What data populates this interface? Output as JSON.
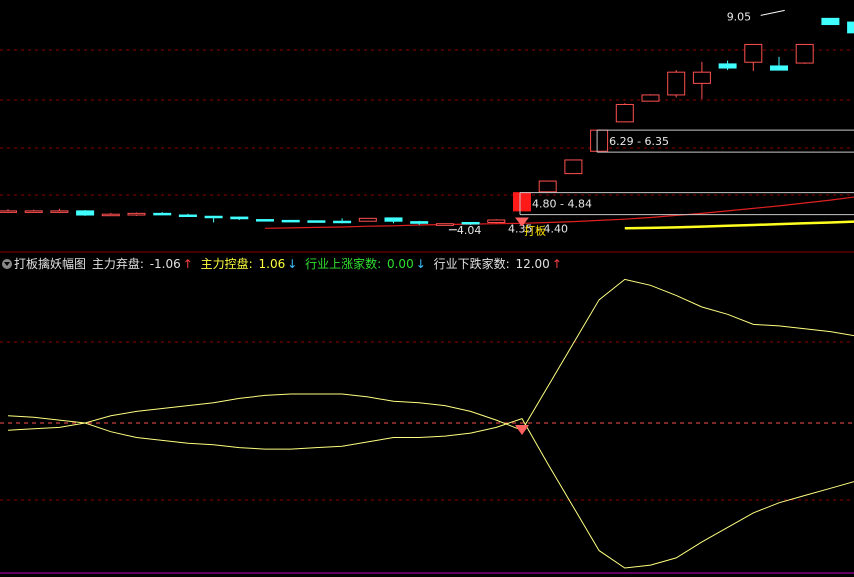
{
  "chart_data": [
    {
      "type": "candlestick",
      "ylim": [
        3.6,
        9.3
      ],
      "candles": [
        {
          "o": 4.4,
          "h": 4.44,
          "l": 4.36,
          "c": 4.4
        },
        {
          "o": 4.4,
          "h": 4.43,
          "l": 4.38,
          "c": 4.4
        },
        {
          "o": 4.38,
          "h": 4.45,
          "l": 4.36,
          "c": 4.4
        },
        {
          "o": 4.4,
          "h": 4.42,
          "l": 4.28,
          "c": 4.3
        },
        {
          "o": 4.32,
          "h": 4.35,
          "l": 4.28,
          "c": 4.32
        },
        {
          "o": 4.3,
          "h": 4.36,
          "l": 4.28,
          "c": 4.34
        },
        {
          "o": 4.34,
          "h": 4.37,
          "l": 4.3,
          "c": 4.32
        },
        {
          "o": 4.3,
          "h": 4.33,
          "l": 4.26,
          "c": 4.28
        },
        {
          "o": 4.27,
          "h": 4.28,
          "l": 4.12,
          "c": 4.26
        },
        {
          "o": 4.25,
          "h": 4.26,
          "l": 4.18,
          "c": 4.21
        },
        {
          "o": 4.19,
          "h": 4.2,
          "l": 4.15,
          "c": 4.17
        },
        {
          "o": 4.17,
          "h": 4.18,
          "l": 4.14,
          "c": 4.16
        },
        {
          "o": 4.16,
          "h": 4.17,
          "l": 4.13,
          "c": 4.15
        },
        {
          "o": 4.15,
          "h": 4.22,
          "l": 4.1,
          "c": 4.12
        },
        {
          "o": 4.15,
          "h": 4.22,
          "l": 4.15,
          "c": 4.22
        },
        {
          "o": 4.23,
          "h": 4.24,
          "l": 4.1,
          "c": 4.15
        },
        {
          "o": 4.14,
          "h": 4.16,
          "l": 4.06,
          "c": 4.1
        },
        {
          "o": 4.05,
          "h": 4.1,
          "l": 4.04,
          "c": 4.09
        },
        {
          "o": 4.12,
          "h": 4.13,
          "l": 4.06,
          "c": 4.1
        },
        {
          "o": 4.12,
          "h": 4.2,
          "l": 4.1,
          "c": 4.18
        },
        {
          "o": 4.4,
          "h": 4.84,
          "l": 4.4,
          "c": 4.84
        },
        {
          "o": 4.86,
          "h": 5.12,
          "l": 4.86,
          "c": 5.12
        },
        {
          "o": 5.3,
          "h": 5.63,
          "l": 5.3,
          "c": 5.63
        },
        {
          "o": 5.84,
          "h": 6.35,
          "l": 5.84,
          "c": 6.35
        },
        {
          "o": 6.55,
          "h": 7.0,
          "l": 6.55,
          "c": 6.97
        },
        {
          "o": 7.05,
          "h": 7.22,
          "l": 7.05,
          "c": 7.2
        },
        {
          "o": 7.2,
          "h": 7.8,
          "l": 7.14,
          "c": 7.75
        },
        {
          "o": 7.48,
          "h": 8.0,
          "l": 7.1,
          "c": 7.75
        },
        {
          "o": 7.95,
          "h": 8.03,
          "l": 7.8,
          "c": 7.85
        },
        {
          "o": 7.99,
          "h": 8.28,
          "l": 7.78,
          "c": 8.42
        },
        {
          "o": 7.9,
          "h": 8.12,
          "l": 7.79,
          "c": 7.8
        },
        {
          "o": 7.97,
          "h": 8.42,
          "l": 7.95,
          "c": 8.42
        },
        {
          "o": 9.05,
          "h": 9.05,
          "l": 8.9,
          "c": 8.9
        },
        {
          "o": 8.96,
          "h": 8.97,
          "l": 8.56,
          "c": 8.7
        }
      ],
      "ma_red": [
        null,
        null,
        null,
        null,
        null,
        null,
        null,
        null,
        null,
        null,
        3.98,
        3.99,
        4.0,
        4.01,
        4.03,
        4.04,
        4.06,
        4.07,
        4.08,
        4.09,
        4.1,
        4.12,
        4.14,
        4.17,
        4.2,
        4.24,
        4.29,
        4.34,
        4.4,
        4.46,
        4.52,
        4.59,
        4.66,
        4.74
      ],
      "ma_yellow": [
        null,
        null,
        null,
        null,
        null,
        null,
        null,
        null,
        null,
        null,
        null,
        null,
        null,
        null,
        null,
        null,
        null,
        null,
        null,
        null,
        null,
        null,
        null,
        null,
        3.98,
        3.99,
        4.0,
        4.02,
        4.04,
        4.06,
        4.08,
        4.1,
        4.12,
        4.14
      ],
      "price_labels": [
        {
          "index": 31,
          "price": 9.05,
          "text": "9.05"
        },
        {
          "index": 17,
          "price": 4.04,
          "text": "4.04"
        }
      ],
      "range_labels": [
        {
          "index": 23,
          "price": 6.35,
          "text": "6.29 - 6.35"
        },
        {
          "index": 20,
          "price": 4.84,
          "text": "4.80 - 4.84"
        },
        {
          "index": 20,
          "price": 4.12,
          "text": "4.35 - 4.40"
        }
      ],
      "signal_text": "打板"
    },
    {
      "type": "line",
      "title": "打板擒妖幅图",
      "ylim": [
        -1,
        1
      ],
      "series": [
        {
          "name": "主力弃盘",
          "color": "#ffff80",
          "values": [
            0.05,
            0.04,
            0.02,
            0.0,
            0.05,
            0.08,
            0.1,
            0.12,
            0.14,
            0.17,
            0.19,
            0.2,
            0.2,
            0.2,
            0.18,
            0.15,
            0.14,
            0.12,
            0.08,
            0.02,
            -0.05,
            0.25,
            0.55,
            0.85,
            0.99,
            0.95,
            0.88,
            0.8,
            0.75,
            0.68,
            0.67,
            0.65,
            0.63,
            0.6
          ]
        },
        {
          "name": "主力控盘",
          "color": "#ffff80",
          "values": [
            -0.05,
            -0.04,
            -0.03,
            0.0,
            -0.06,
            -0.1,
            -0.12,
            -0.14,
            -0.15,
            -0.17,
            -0.18,
            -0.18,
            -0.17,
            -0.16,
            -0.13,
            -0.1,
            -0.1,
            -0.09,
            -0.07,
            -0.03,
            0.03,
            -0.28,
            -0.58,
            -0.88,
            -1.0,
            -0.98,
            -0.93,
            -0.82,
            -0.72,
            -0.62,
            -0.55,
            -0.5,
            -0.45,
            -0.4
          ]
        }
      ],
      "legend": [
        {
          "label": "主力弃盘: ",
          "value": "-1.06",
          "arrow": "↑",
          "color": "#e0e0e0"
        },
        {
          "label": "主力控盘: ",
          "value": "1.06",
          "arrow": "↓",
          "color": "#ffff40"
        },
        {
          "label": "行业上涨家数: ",
          "value": "0.00",
          "arrow": "↓",
          "color": "#30e030"
        },
        {
          "label": "行业下跌家数: ",
          "value": "12.00",
          "arrow": "↑",
          "color": "#e0e0e0"
        }
      ]
    }
  ]
}
